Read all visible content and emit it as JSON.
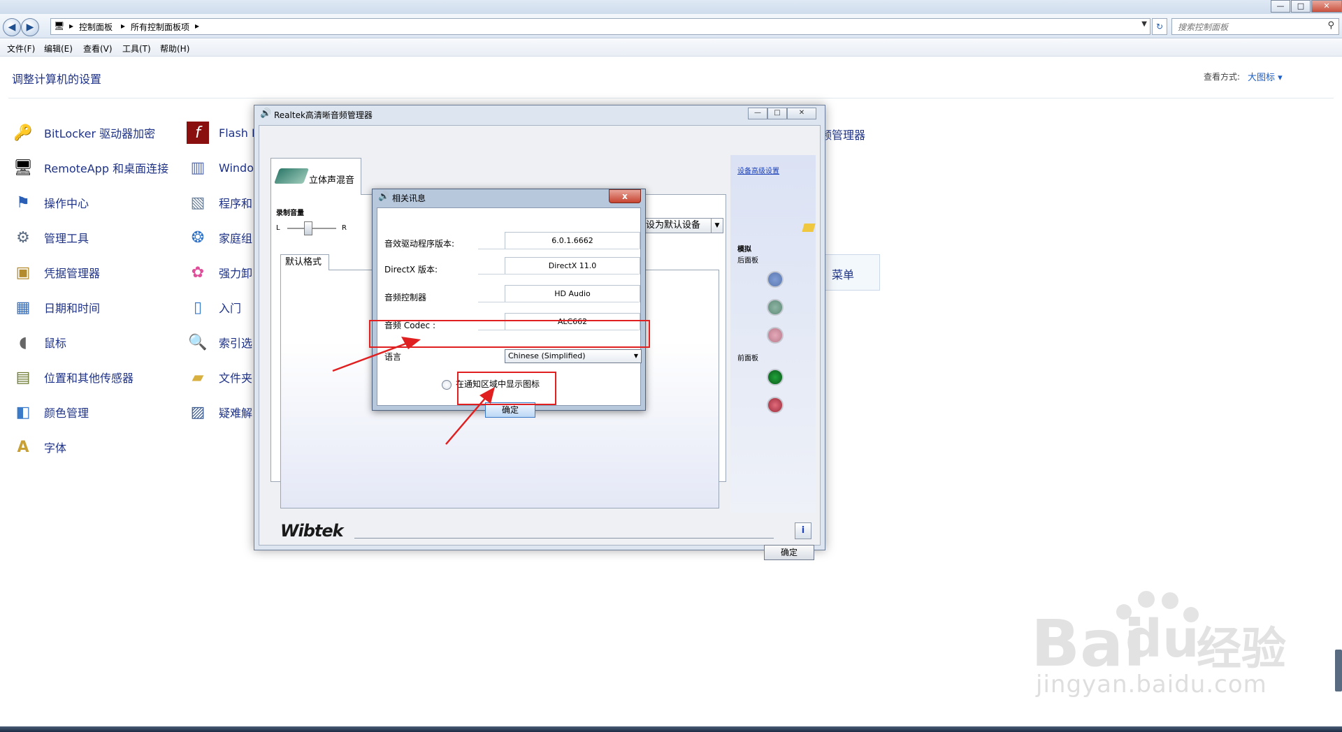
{
  "window": {
    "min": "—",
    "max": "□",
    "close": "✕"
  },
  "address": {
    "crumb1": "控制面板",
    "crumb2": "所有控制面板项",
    "search_placeholder": "搜索控制面板"
  },
  "menu": {
    "file": "文件(F)",
    "edit": "编辑(E)",
    "view": "查看(V)",
    "tools": "工具(T)",
    "help": "帮助(H)"
  },
  "control_panel": {
    "title": "调整计算机的设置",
    "view_by_label": "查看方式:",
    "view_by_value": "大图标 ▾",
    "col1": [
      {
        "label": "BitLocker 驱动器加密",
        "icon": "bitlocker-icon"
      },
      {
        "label": "RemoteApp 和桌面连接",
        "icon": "remoteapp-icon"
      },
      {
        "label": "操作中心",
        "icon": "action-center-icon"
      },
      {
        "label": "管理工具",
        "icon": "admin-tools-icon"
      },
      {
        "label": "凭据管理器",
        "icon": "credential-icon"
      },
      {
        "label": "日期和时间",
        "icon": "datetime-icon"
      },
      {
        "label": "鼠标",
        "icon": "mouse-icon"
      },
      {
        "label": "位置和其他传感器",
        "icon": "sensor-icon"
      },
      {
        "label": "颜色管理",
        "icon": "color-icon"
      },
      {
        "label": "字体",
        "icon": "font-icon"
      }
    ],
    "col2": [
      {
        "label": "Flash P",
        "icon": "flash-icon"
      },
      {
        "label": "Windo",
        "icon": "windows-icon"
      },
      {
        "label": "程序和",
        "icon": "programs-icon"
      },
      {
        "label": "家庭组",
        "icon": "homegroup-icon"
      },
      {
        "label": "强力卸",
        "icon": "uninstall-icon"
      },
      {
        "label": "入门",
        "icon": "getting-started-icon"
      },
      {
        "label": "索引选",
        "icon": "index-icon"
      },
      {
        "label": "文件夹",
        "icon": "folder-icon"
      },
      {
        "label": "疑难解",
        "icon": "troubleshoot-icon"
      }
    ],
    "behind_audio_mgr": "频管理器",
    "behind_menu": "菜单"
  },
  "realtek": {
    "title": "Realtek高清晰音频管理器",
    "tab_label": "立体声混音",
    "rec_volume_label": "录制音量",
    "left": "L",
    "right": "R",
    "set_default": "设为默认设备",
    "subtab": "默认格式",
    "advanced_link": "设备高级设置",
    "analog": "模拟",
    "back_panel": "后面板",
    "front_panel": "前面板",
    "brand": "Wibtek",
    "info": "i",
    "ok": "确定"
  },
  "about_dialog": {
    "title": "相关讯息",
    "close": "x",
    "rows": [
      {
        "label": "音效驱动程序版本:",
        "value": "6.0.1.6662"
      },
      {
        "label": "DirectX 版本:",
        "value": "DirectX 11.0"
      },
      {
        "label": "音频控制器",
        "value": "HD Audio"
      },
      {
        "label": "音频 Codec :",
        "value": "ALC662"
      }
    ],
    "language_label": "语言",
    "language_value": "Chinese (Simplified)",
    "tray_option": "在通知区域中显示图标",
    "ok": "确定"
  },
  "watermark": {
    "brand": "Bai",
    "brand2": "du",
    "cn": "经验",
    "url": "jingyan.baidu.com"
  },
  "colors": {
    "link_blue": "#1e3287",
    "annotation_red": "#e02020"
  }
}
